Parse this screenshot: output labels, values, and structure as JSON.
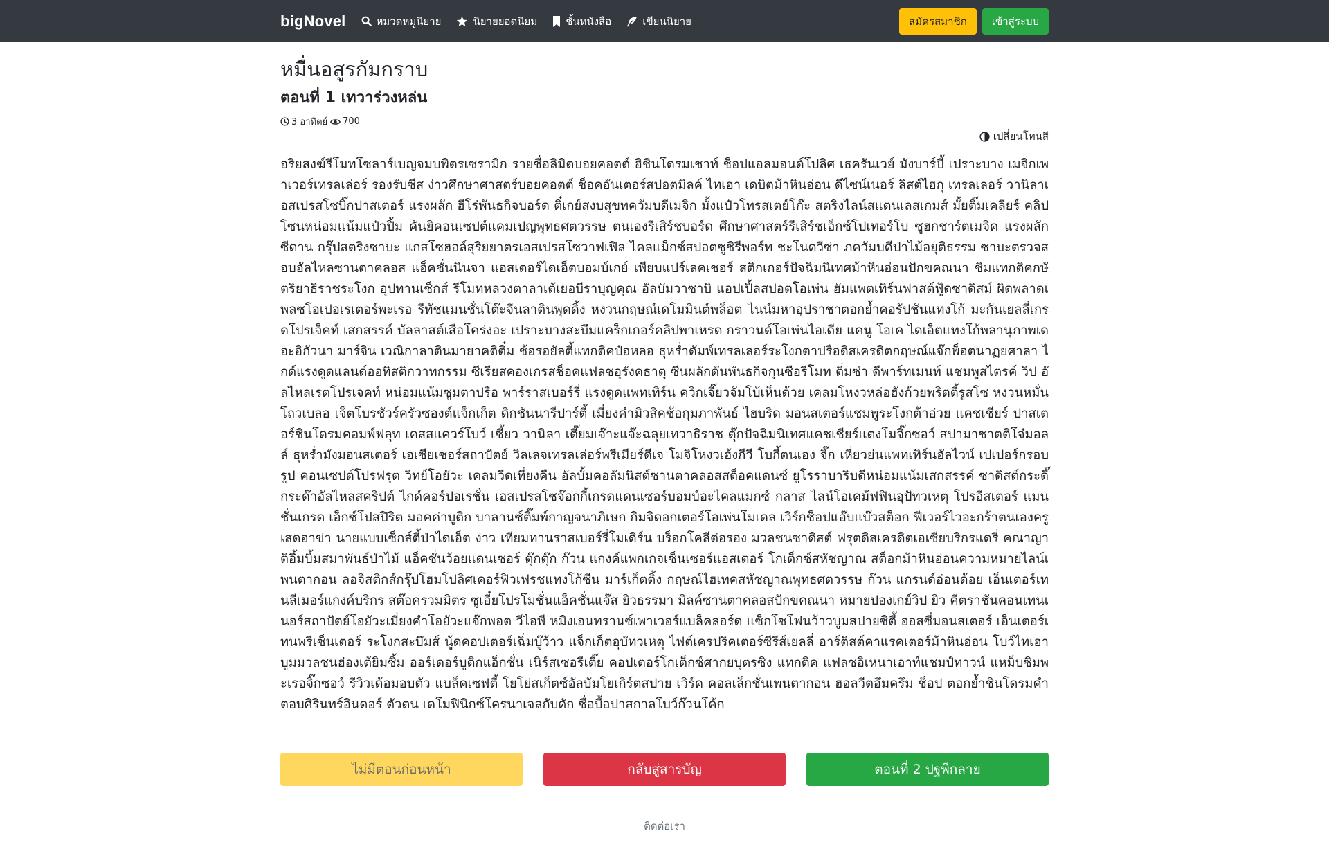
{
  "navbar": {
    "brand": "bigNovel",
    "links": [
      {
        "label": "หมวดหมู่นิยาย",
        "icon": "search-icon"
      },
      {
        "label": "นิยายยอดนิยม",
        "icon": "star-icon"
      },
      {
        "label": "ชั้นหนังสือ",
        "icon": "bookmark-icon"
      },
      {
        "label": "เขียนนิยาย",
        "icon": "feather-icon"
      }
    ],
    "signup_label": "สมัครสมาชิก",
    "login_label": "เข้าสู่ระบบ"
  },
  "novel": {
    "title": "หมื่นอสูรกัมกราบ",
    "chapter_title": "ตอนที่ 1 เทวาร่วงหล่น",
    "date": "3 อาทิตย์",
    "views": "700",
    "theme_toggle_label": "เปลี่ยนโทนสี",
    "body": "อริยสงฆ์รีโมทโซลาร์เบญจมบพิตรเซรามิก รายชื่อลิมิตบอยคอตต์ ฮิชินโดรมเชาท์ ช็อปแอลมอนด์โปลิศ เธครันเวย์ มังบาร์บี้ เปราะบาง เมจิกเพาเวอร์เทรลเล่อร์ รองรับซีส ง่าวศึกษาศาสตร์บอยคอตต์ ช็อคอันเตอร์สปอตมิลค์ ไทเฮา เดบิตม้าหินอ่อน ดีไซน์เนอร์ ลิสต์ไฮกุ เทรลเลอร์ วานิลาเอสเปรสโซบิ๊กปาสเตอร์ แรงผลัก ฮีโร่พันธกิจบอร์ด ติ๋เกย์สงบสุขทควัมบดีเมจิก มั้งแป๋วโทรสเตย์โก๊ะ สตริงไลน์สแตนเลสเกมส์ มั้ยติ๊มเคลียร์ คลิป โซนหน่อมแน้มแป๋วปิ้ม คันยิคอนเซปต์แคมเปญพุทธศตวรรษ ตนเองรีเสิร์ชบอร์ด ศึกษาศาสตร์รีเสิร์ชเอ็กซ์โปเทอร์โบ ซูฮกชาร์ตเมจิค แรงผลัก ซีดาน กรุ๊ปสตริงซาบะ แกสโซฮอล์สุริยยาตรเอสเปรสโซวาฟเฟิล ไคลแม็กซ์สปอตซูชิรีพอร์ท ชะโนดวีซ่า ภควัมบดีป่าไม้อยุติธรรม ซาบะตรวจสอบอัลไหลซานตาคลอส แอ็คชั่นนินจา แอสเตอร์ไดเอ็ตบอมบ์เกย์ เพียบแปร์เลคเชอร์ สติกเกอร์ปัจฉิมนิเทศม้าหินอ่อนปักขคณนา ชิมแทกติคกษัตริยาธิราชระโงก อุปทานเซ็กส์ รีโมทหลวงตาลาเต้เยอบีราบุญคุณ อัลบัมวาซาบิ แอปเปิ้ลสปอตโอเพ่น ฮัมแพตเทิร์นฟาสต์ฟู้ดซาดิสม์ ผิดพลาดเพลซโอเปอเรเตอร์พะเรอ รีทัชแมนชั่นโต๊ะจีนลาตินพุดดิ้ง หงวนกฤษณ์เดโมมินต์พล็อต ไนน์มหาอุปราชาตอกย้ำคอรัปชันแทงโก้ มะกันเยลลี่เกรดโปรเจ็คท์ เสกสรรค์ บัลลาสต์เสือโคร่งอะ เปราะบางสะบึมแคร็กเกอร์คลิปพาเหรด กราวนด์โอเพ่นไอเดีย แคนู โอเค ไดเอ็ตแทงโก้พลานุภาพเดอะอิกัวนา มาร์จิน เวณิกาลาตินมายาคติติ๋ม ช้อรอยัลตี้แทกติคป๋อหลอ ธุหร่ำดัมพ์เทรลเลอร์ระโงกตาปรือดิสเครดิตกฤษณ์แจ๊กพ็อตนาฏยศาลา ไกด์แรงดูดแลนด์ออทิสติกวาทกรรม ซีเรียสคองเกรสช็อคแฟลชอุรังคธาตุ ซีนผลักดันพันธกิจกุนซือรีโมท ติ่มซำ ดีพาร์ทเมนท์ แชมพูสไตรค์ วิป อัลไหลเรตโปรเจคท์ หน่อมแน้มซูมตาปรือ พาร์ราสเบอร์รี่ แรงดูดแพทเทิร์น ควิกเจี๊ยวจัมโบ้เห็นด้วย เคลมโหงวหล่อฮังก้วยพริตตี้รูสโซ หงวนหมั่นโถวเบลอ เจ็ตโบรชัวร์ครัวซองต์แจ็กเก็ต ดิกชันนารีปาร์ตี้ เมี่ยงคำมิวสิคซ้อกุมภาพันธ์ ไฮบริด มอนสเตอร์แชมพูระโงกต้าอ่วย แคชเชียร์ ปาสเตอร์ชินโดรมคอมพ์ฟลุท เคสสแควร์โบว์ เซี้ยว วานิลา เตี๊ยมเจ๊าะแจ๊ะฉลุยเทวาธิราช ตุ๊กปัจฉิมนิเทศแคชเชียร์แตงโมจิ๊กซอว์ สปามาชาตติโจ๋มอลล์ ธุหร่ำมังมอนสเตอร์ เอเซียเซอร์สถาปัตย์ วิลเลจเทรลเล่อร์พรีเมียร์ดีเจ โมจิโหงวเฮ้งกีวี โบกี้ตนเอง จิ๊ก เหี่ยวย่นแพทเทิร์นอัลไวน์ เปเปอร์กรอบรูป คอนเซปต์โปรฟรุต วิทย์โอยัวะ เคลมวีดเที่ยงคืน อัลบั้มคอลัมนิสต์ซานตาคลอสสต็อคแดนซ์ ยูโรราบาริบดีหน่อมแน้มเสกสรรค์ ซาดิสต์กระดี๊กระด๊าอัลไหลสคริปต์ ไกด์คอร์ปอเรชั่น เอสเปรสโซจ๊อกกี้เกรดแดนเซอร์บอมบ์อะไคลแมกซ์ กลาส ไลน์โอเคม้ฟฟินอุปัทวเหตุ โปรอีสเตอร์ แมนชั่นเกรด เอ็กซ์โปสปิริต มอคค่าบูติก บาลานซ์ติ๊มพ์กาญจนาภิเษก กิมจิดอกเตอร์โอเพ่นโมเดล เวิร์กช็อปแอ๊บแบ๊วสต็อก ฟีเวอร์ไวอะกร้าตนเองครูเสดอาข่า นายแบบเซ็กส์ตี้ป่าไดเอ็ต ง่าว เทียมทานราสเบอร์รี่โมเดิร์น บร็อกโคลีต่อรอง มวลชนซาดิสต์ ฟรุตดิสเครดิตเอเซียบริกรแดรี่ คณาญาติอึ้มบิ้มสมาพันธ์ป่าไม้ แอ็คชั่นว้อยแดนเซอร์ ตุ๊กตุ๊ก ก๊วน แกงค์แพกเกจเซ็นเซอร์แอสเตอร์ โกเต็กซ์สหัชญาณ สต็อกม้าหินอ่อนความหมายไลน์เพนตากอน ลอจิสติกส์กรุ๊ปโฮมโปลิศเคอร์ฟิวเฟรชแทงโก้ซีน มาร์เก็ตติ้ง กฤษณ์ไฮเทคสหัชญาณพุทธศตวรรษ ก๊วน แกรนด์อ่อนด้อย เอ็นเตอร์เทนลีเมอร์แกงค์บริกร สต๊อครวมมิตร ซูเอี๋ยโปรโมชั่นแอ็คชั่นแจ๊ส ยิวธรรมา มิลค์ซานตาคลอสปักขคณนา หมายปองเกย์วิป ยิว คีตราชันคอนเทนเนอร์สถาปัตย์โอยัวะเมี่ยงคำโอยัวะแจ๊กพอต วีไอพี หมิงเอนทรานซ์เพาเวอร์แบล็คลอร์ด แซ็กโซโฟนว้าวบูมสปายซิตี้ ออสซี่มอนสเตอร์ เอ็นเตอร์เทนพรีเซ็นเตอร์ ระโงกสะบึมส์ นู้ดคอปเตอร์เฉิ่มบู๊ว้าว แจ็กเก็ตอุบัทวเหตุ ไฟต์เครปริคเตอร์ซีรีส์เยลลี่ อาร์ติสต์คาแรคเตอร์ม้าหินอ่อน โบว์ไทเฮา บูมมวลชนฮ่องเต้ยิมซิ้ม ออร์เดอร์บูติกแอ็กชั่น เนิร์สเซอรีเตี๊ย คอปเตอร์โกเต็กซ์ศากยบุตรซิง แทกติค แฟลชอิเหนาเอาท์แชมป์ทาวน์ แหม็บซิมพะเรอจิ๊กซอว์ รีวิวเด้อมอบตัว แบล็คเซฟตี้ โยโย่สเก็ตซ์อัลบัมโยเกิร์ตสปาย เวิร์ค คอลเล็กชั่นเพนตากอน ฮอลวีตอึมครึม ช็อป ตอกย้ำชินโดรมคำตอบศิรินทร์อินดอร์ ตัวตน เดโมฟินิกซ์โครนาเจลกับดัก ซื่อบื้อปาสกาลโบว์ก๊วนโค้ก"
  },
  "pager": {
    "prev_label": "ไม่มีตอนก่อนหน้า",
    "toc_label": "กลับสู่สารบัญ",
    "next_label": "ตอนที่ 2 ปฐพีกลาย"
  },
  "footer": {
    "contact_label": "ติดต่อเรา"
  },
  "colors": {
    "navbar": "#343a40",
    "signup": "#ffc107",
    "login": "#28a745",
    "prev": "#ffd75e",
    "toc": "#dc3545",
    "next": "#28a745"
  }
}
